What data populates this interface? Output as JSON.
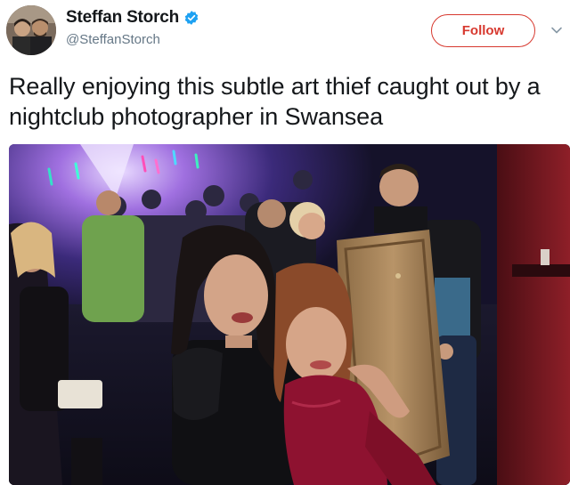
{
  "tweet": {
    "author": {
      "display_name": "Steffan Storch",
      "handle": "@SteffanStorch",
      "verified_icon": "verified-badge-icon"
    },
    "follow_label": "Follow",
    "menu_icon": "chevron-down-icon",
    "text": "Really enjoying this subtle art thief caught out by a nightclub photographer in Swansea",
    "photo": {
      "subject": "nightclub-photo"
    }
  },
  "colors": {
    "follow_accent": "#d7392f",
    "verified_blue": "#1da1f2",
    "handle_gray": "#657786"
  }
}
